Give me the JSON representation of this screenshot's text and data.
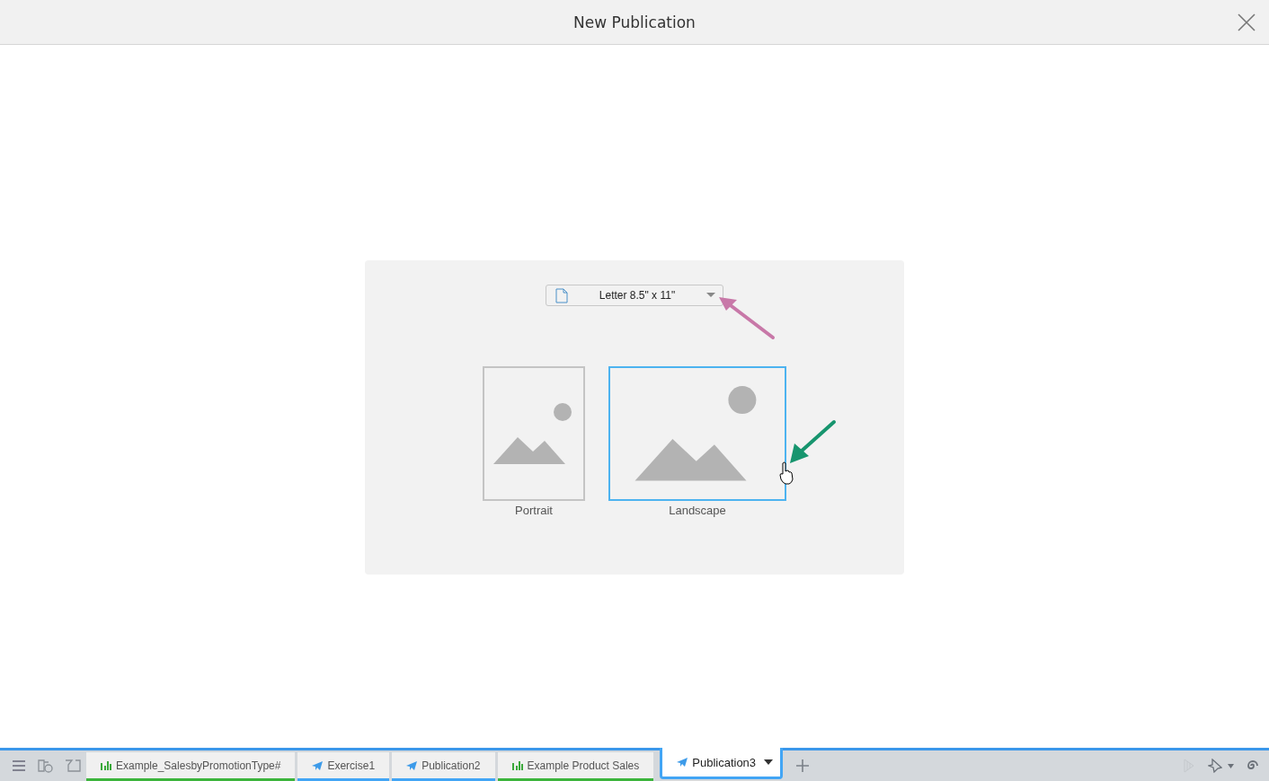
{
  "window": {
    "title": "New Publication"
  },
  "page_size": {
    "value": "Letter 8.5\" x 11\""
  },
  "orientations": [
    {
      "label": "Portrait",
      "kind": "portrait",
      "selected": false
    },
    {
      "label": "Landscape",
      "kind": "landscape",
      "selected": true
    }
  ],
  "tabs": [
    {
      "label": "Example_SalesbyPromotionType#",
      "kind": "chart",
      "color": "#3cb43c",
      "selected": false
    },
    {
      "label": "Exercise1",
      "kind": "publication",
      "color": "#42a5f5",
      "selected": false
    },
    {
      "label": "Publication2",
      "kind": "publication",
      "color": "#42a5f5",
      "selected": false
    },
    {
      "label": "Example Product Sales",
      "kind": "chart",
      "color": "#3cb43c",
      "selected": false
    },
    {
      "label": "Publication3",
      "kind": "publication",
      "color": "#42a5f5",
      "selected": true
    }
  ]
}
